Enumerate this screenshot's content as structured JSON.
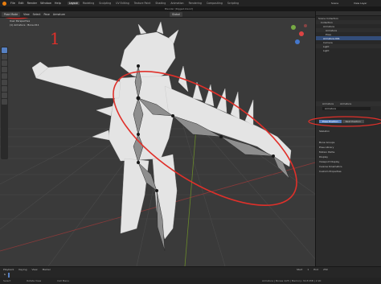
{
  "topbar": {
    "menus": [
      "File",
      "Edit",
      "Render",
      "Window",
      "Help"
    ],
    "workspaces": [
      "Layout",
      "Modeling",
      "Sculpting",
      "UV Editing",
      "Texture Paint",
      "Shading",
      "Animation",
      "Rendering",
      "Compositing",
      "Scripting"
    ],
    "active_workspace": "Layout",
    "scene": "Scene",
    "view_layer": "View Layer"
  },
  "title": "Blender [Rigged.blend]",
  "viewport_header": {
    "mode": "Pose Mode",
    "view": "View",
    "select": "Select",
    "pose": "Pose",
    "armature": "Armature",
    "transform": "Global",
    "info_line1": "User Perspective",
    "info_line2": "(1) Armature : Bone.011",
    "annotation_number": "1"
  },
  "outliner": {
    "rows": [
      {
        "label": "Scene Collection"
      },
      {
        "label": "Collection"
      },
      {
        "label": "Armature"
      },
      {
        "label": "Armature"
      },
      {
        "label": "Pose"
      },
      {
        "label": "Armature.001"
      },
      {
        "label": "Camera"
      },
      {
        "label": "Light"
      },
      {
        "label": "Light"
      }
    ]
  },
  "properties": {
    "tab1": "Armature",
    "tab2": "Armature",
    "name_field": "Armature",
    "pose_position": "Pose Position",
    "rest_position": "Rest Position",
    "sections": [
      "Skeleton",
      "Bone Groups",
      "Pose Library",
      "Motion Paths",
      "Display",
      "Viewport Display",
      "Inverse Kinematics",
      "Custom Properties"
    ]
  },
  "timeline": {
    "items": [
      "Playback",
      "Keying",
      "View",
      "Marker"
    ],
    "start_label": "Start",
    "start": "1",
    "end_label": "End",
    "end": "250",
    "current_frame": "1"
  },
  "statusbar": {
    "left": "Select",
    "middle": "Rotate View",
    "right": "Call Menu",
    "stats": "Armature | Bones 1/25 | Memory: 30.8 MiB | 2.90"
  },
  "colors": {
    "accent": "#5680c2",
    "annotation": "#e0302a",
    "viewport_bg": "#3a3a3a"
  }
}
